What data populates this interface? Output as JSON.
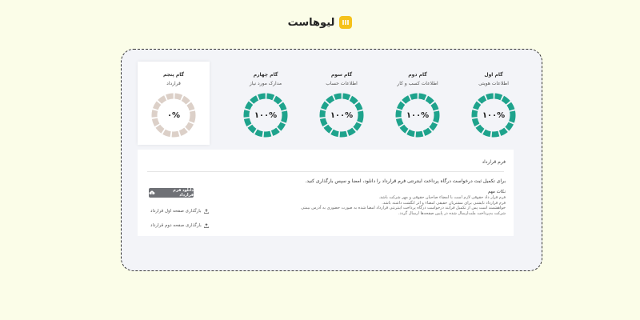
{
  "brand": {
    "name": "لیوهاست"
  },
  "steps": [
    {
      "title": "گام اول",
      "subtitle": "اطلاعات هویتی",
      "percent": "۱۰۰%",
      "progress": 100
    },
    {
      "title": "گام دوم",
      "subtitle": "اطلاعات کسب و کار",
      "percent": "۱۰۰%",
      "progress": 100
    },
    {
      "title": "گام سوم",
      "subtitle": "اطلاعات حساب",
      "percent": "۱۰۰%",
      "progress": 100
    },
    {
      "title": "گام چهارم",
      "subtitle": "مدارک مورد نیاز",
      "percent": "۱۰۰%",
      "progress": 100
    },
    {
      "title": "گام پنجم",
      "subtitle": "قرارداد",
      "percent": "۰%",
      "progress": 0
    }
  ],
  "colors": {
    "complete": "#1ea38c",
    "pending": "#dcd0c8"
  },
  "contract": {
    "title": "فرم قرارداد",
    "description": "برای تکمیل ثبت درخواست درگاه پرداخت اینترنتی فرم قرارداد را دانلود، امضا و سپس بارگذاری کنید.",
    "notes_title": "نکات مهم",
    "notes": [
      "فرم قرار داد حقوقی لازم است با امضاء صاحبان حقوقی و مهر شرکت باشد.",
      "فرم قرارداد نایشنی برای مشتریان حقیقی امضاء و اثر انگشت داشته باشد.",
      "خواهشمند است پس از تکمیل فرایند درخواست درگاه پرداخت اینترنتی قرارداد امضا شده به صورت حضوری به آدرس بیمتی",
      "شرکت به‌پرداخت ملت‌ارسال شده در پایین صفحه‌ها ارسال گردد."
    ],
    "download_label": "دانلود فرم قرارداد",
    "upload_page1": "بارگذاری صفحه اول قرارداد",
    "upload_page2": "بارگذاری صفحه دوم قرارداد"
  }
}
